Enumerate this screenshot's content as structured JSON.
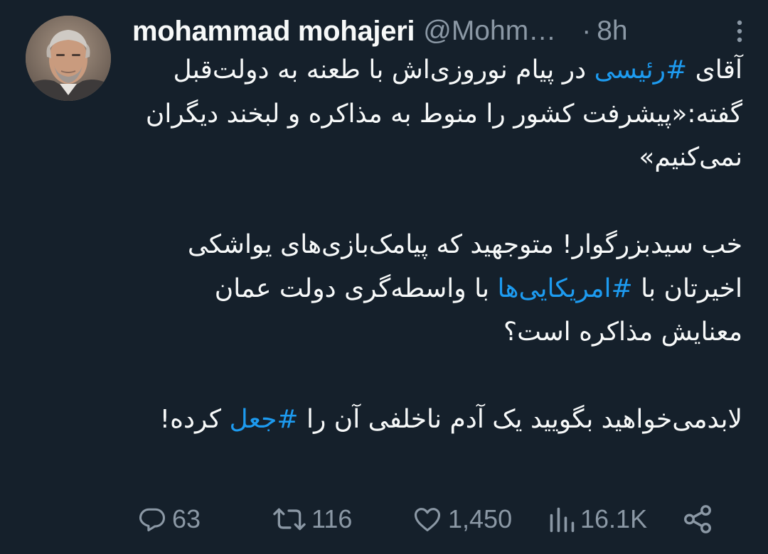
{
  "tweet": {
    "display_name": "mohammad mohajeri",
    "handle": "@Mohm…",
    "separator": "·",
    "time": "8h"
  },
  "body": {
    "p1": {
      "pre": "آقای ",
      "hashtag": "#رئیسی",
      "post": " در پیام نوروزی‌اش با طعنه به دولت‌قبل گفته:«پیشرفت کشور را منوط به مذاکره و لبخند دیگران نمی‌کنیم»"
    },
    "p2": {
      "pre": "خب سیدبزرگوار! متوجهید که پیامک‌بازی‌های یواشکی اخیرتان با ",
      "hashtag": "#امریکایی‌ها",
      "post": " با واسطه‌گری دولت عمان معنایش مذاکره است؟"
    },
    "p3": {
      "pre": "لابدمی‌خواهید بگویید یک آدم ناخلفی آن را ",
      "hashtag": "#جعل",
      "post": " کرده!"
    }
  },
  "actions": {
    "replies": "63",
    "retweets": "116",
    "likes": "1,450",
    "views": "16.1K"
  },
  "icons": {
    "more": "more-vertical-icon",
    "reply": "reply-icon",
    "retweet": "retweet-icon",
    "like": "heart-icon",
    "views": "views-icon",
    "share": "share-icon"
  },
  "colors": {
    "background": "#15202b",
    "text": "#f7f9f9",
    "secondary": "#8b98a5",
    "link": "#1d9bf0"
  }
}
